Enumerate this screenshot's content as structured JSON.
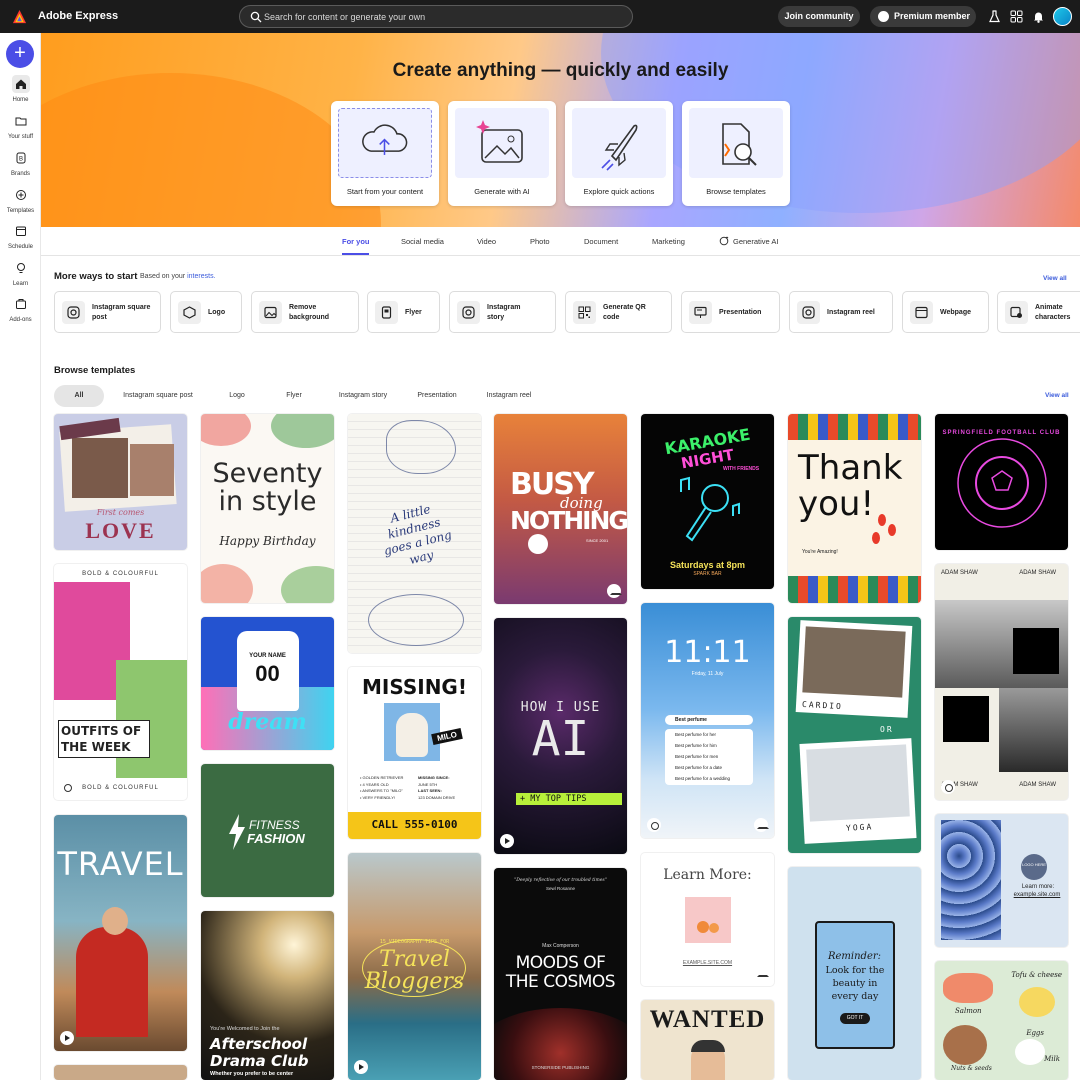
{
  "app": {
    "title": "Adobe Express"
  },
  "search": {
    "placeholder": "Search for content or generate your own"
  },
  "header": {
    "join_label": "Join community",
    "premium_label": "Premium member"
  },
  "rail": {
    "create_label": "+",
    "items": [
      {
        "label": "Home"
      },
      {
        "label": "Your stuff"
      },
      {
        "label": "Brands"
      },
      {
        "label": "Templates"
      },
      {
        "label": "Schedule"
      },
      {
        "label": "Learn"
      },
      {
        "label": "Add-ons"
      }
    ]
  },
  "hero": {
    "title": "Create anything — quickly and easily",
    "cards": [
      {
        "label": "Start from your content"
      },
      {
        "label": "Generate with AI"
      },
      {
        "label": "Explore quick actions"
      },
      {
        "label": "Browse templates"
      }
    ]
  },
  "tabs": [
    "For you",
    "Social media",
    "Video",
    "Photo",
    "Document",
    "Marketing",
    "Generative AI"
  ],
  "more_ways": {
    "title": "More ways to start",
    "note_prefix": "Based on your",
    "note_link": "interests.",
    "view_all": "View all",
    "items": [
      {
        "label": "Instagram square post"
      },
      {
        "label": "Logo"
      },
      {
        "label": "Remove background"
      },
      {
        "label": "Flyer"
      },
      {
        "label": "Instagram story"
      },
      {
        "label": "Generate QR code"
      },
      {
        "label": "Presentation"
      },
      {
        "label": "Instagram reel"
      },
      {
        "label": "Webpage"
      },
      {
        "label": "Animate characters"
      }
    ]
  },
  "browse": {
    "title": "Browse templates",
    "view_all": "View all",
    "filters": [
      "All",
      "Instagram square post",
      "Logo",
      "Flyer",
      "Instagram story",
      "Presentation",
      "Instagram reel"
    ]
  },
  "templates": {
    "love": {
      "line1": "First comes",
      "line2": "LOVE"
    },
    "seventy": {
      "line1": "Seventy",
      "line2": "in style",
      "line3": "Happy Birthday"
    },
    "kindness": {
      "text": "A little kindness goes a long way"
    },
    "busy": {
      "line1": "BUSY",
      "line2": "doing",
      "line3": "NOTHING",
      "small": "SINCE 2001"
    },
    "karaoke": {
      "line1": "KARAOKE",
      "line2": "NIGHT",
      "small": "WITH FRIENDS",
      "foot": "Saturdays at 8pm",
      "foot2": "SPARK BAR"
    },
    "thankyou": {
      "line1": "Thank",
      "line2": "you!",
      "small": "You're Amazing!"
    },
    "football": {
      "text": "SPRINGFIELD FOOTBALL CLUB"
    },
    "outfits": {
      "top": "BOLD & COLOURFUL",
      "line1": "OUTFITS OF",
      "line2": "THE WEEK",
      "bottom": "BOLD & COLOURFUL"
    },
    "jersey": {
      "name": "YOUR NAME",
      "num": "00",
      "script": "dream"
    },
    "missing": {
      "title": "MISSING!",
      "tag": "MILO",
      "info1": "• GOLDEN RETRIEVER",
      "info2": "• 4 YEARS OLD",
      "info3": "• ANSWERS TO \"MILO\"",
      "info4": "• VERY FRIENDLY!",
      "since_label": "MISSING SINCE:",
      "since": "JUNE 5TH",
      "seen_label": "LAST SEEN:",
      "seen": "123 DOMAIN DRIVE",
      "phone": "CALL 555-0100"
    },
    "ai": {
      "line1": "HOW I USE",
      "line2": "AI",
      "band": "+ MY TOP TIPS"
    },
    "lock": {
      "time": "11:11",
      "date": "Friday, 11 July",
      "q": "Best perfume",
      "s1": "Best perfume for her",
      "s2": "Best perfume for him",
      "s3": "Best perfume for men",
      "s4": "Best perfume for a date",
      "s5": "Best perfume for a wedding"
    },
    "cardio": {
      "top": "CARDIO",
      "mid": "OR",
      "bottom": "YOGA"
    },
    "adam": {
      "name": "ADAM SHAW"
    },
    "fitness": {
      "line1": "FITNESS",
      "line2": "FASHION"
    },
    "travel": {
      "text": "TRAVEL"
    },
    "drama": {
      "small": "You're Welcomed to Join the",
      "line1": "Afterschool",
      "line2": "Drama Club",
      "foot": "Whether you prefer to be center"
    },
    "bloggers": {
      "small": "15 VIDEOGRAPHY TIPS FOR",
      "line1": "Travel",
      "line2": "Bloggers"
    },
    "cosmos": {
      "quote": "\"Deeply reflective of our troubled times\"",
      "author": "Sewl Rosanne",
      "name": "Max Comperson",
      "line1": "MOODS OF",
      "line2": "THE COSMOS",
      "pub": "STONERSIDE PUBLISHING"
    },
    "learn": {
      "title": "Learn More:",
      "url": "EXAMPLE.SITE.COM"
    },
    "wanted": {
      "title": "WANTED"
    },
    "reminder": {
      "title": "Reminder:",
      "body": "Look for the beauty in every day",
      "btn": "GOT IT"
    },
    "blue": {
      "logo": "LOGO HERE",
      "learn": "Learn more:",
      "url": "example.site.com"
    },
    "food": {
      "l1": "Tofu & cheese",
      "l2": "Salmon",
      "l3": "Eggs",
      "l4": "Nuts & seeds",
      "l5": "Milk"
    }
  }
}
